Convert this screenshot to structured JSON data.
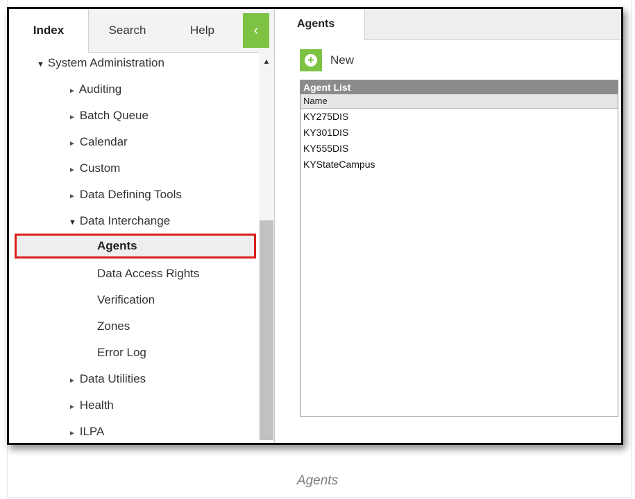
{
  "left_tabs": {
    "index": "Index",
    "search": "Search",
    "help": "Help",
    "collapse": "‹"
  },
  "tree": {
    "root": "System Administration",
    "items": [
      {
        "label": "Auditing"
      },
      {
        "label": "Batch Queue"
      },
      {
        "label": "Calendar"
      },
      {
        "label": "Custom"
      },
      {
        "label": "Data Defining Tools"
      },
      {
        "label": "Data Interchange"
      }
    ],
    "sub_items": [
      {
        "label": "Agents"
      },
      {
        "label": "Data Access Rights"
      },
      {
        "label": "Verification"
      },
      {
        "label": "Zones"
      },
      {
        "label": "Error Log"
      }
    ],
    "more_items": [
      {
        "label": "Data Utilities"
      },
      {
        "label": "Health"
      },
      {
        "label": "ILPA"
      }
    ]
  },
  "right": {
    "tab": "Agents",
    "new_label": "New",
    "list_title": "Agent List",
    "column": "Name",
    "rows": [
      "KY275DIS",
      "KY301DIS",
      "KY555DIS",
      "KYStateCampus"
    ]
  },
  "caption": "Agents",
  "colors": {
    "accent_green": "#7dc242",
    "highlight_red": "#d8201c"
  }
}
